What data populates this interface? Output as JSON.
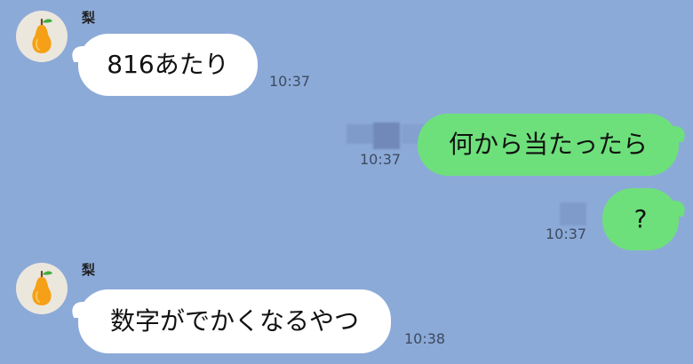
{
  "contact": {
    "name": "梨",
    "avatar_icon": "pear-icon",
    "avatar_bg": "#ece7dd"
  },
  "colors": {
    "background": "#8caad8",
    "incoming_bubble": "#ffffff",
    "outgoing_bubble": "#6de07b"
  },
  "messages": [
    {
      "direction": "incoming",
      "sender": "梨",
      "text": "816あたり",
      "time": "10:37"
    },
    {
      "direction": "outgoing",
      "text": "何から当たったら",
      "time": "10:37"
    },
    {
      "direction": "outgoing",
      "text": "?",
      "time": "10:37"
    },
    {
      "direction": "incoming",
      "sender": "梨",
      "text": "数字がでかくなるやつ",
      "time": "10:38"
    }
  ]
}
